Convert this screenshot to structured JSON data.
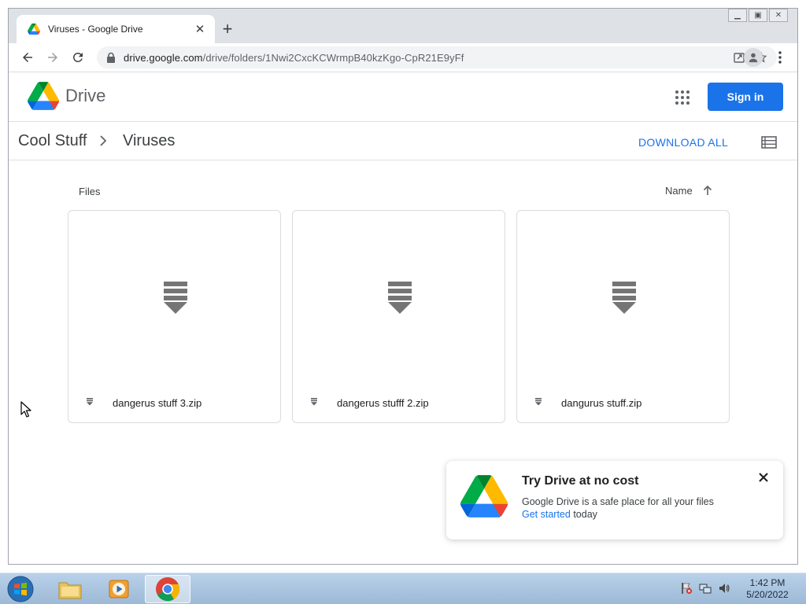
{
  "browser": {
    "tab_title": "Viruses - Google Drive",
    "url_host": "drive.google.com",
    "url_path": "/drive/folders/1Nwi2CxcKCWrmpB40kzKgo-CpR21E9yFf"
  },
  "drive": {
    "wordmark": "Drive",
    "sign_in_label": "Sign in"
  },
  "breadcrumb": {
    "parent": "Cool Stuff",
    "current": "Viruses"
  },
  "actions": {
    "download_all": "DOWNLOAD ALL"
  },
  "files_section": {
    "label": "Files",
    "sort_label": "Name",
    "files": [
      {
        "name": "dangerus stuff 3.zip"
      },
      {
        "name": "dangerus stufff 2.zip"
      },
      {
        "name": "dangurus stuff.zip"
      }
    ]
  },
  "promo": {
    "title": "Try Drive at no cost",
    "text": "Google Drive is a safe place for all your files",
    "link_text": "Get started",
    "link_suffix": " today"
  },
  "taskbar": {
    "time": "1:42 PM",
    "date": "5/20/2022"
  },
  "colors": {
    "accent": "#1a73e8",
    "thumb_gray": "#757575"
  }
}
